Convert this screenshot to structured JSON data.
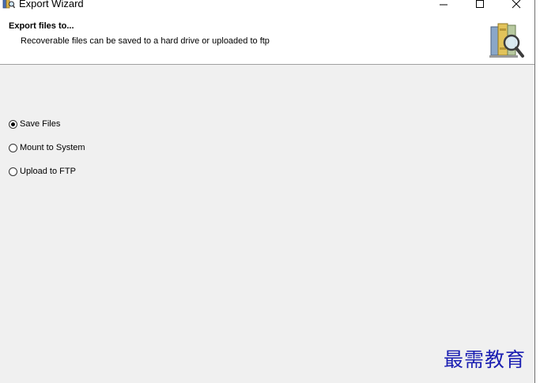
{
  "window": {
    "title": "Export Wizard",
    "controls": {
      "minimize_glyph": "—",
      "maximize_glyph": "☐",
      "close_glyph": "✕"
    }
  },
  "header": {
    "title": "Export files to...",
    "subtitle": "Recoverable files can be saved to a hard drive or uploaded to ftp",
    "icon": "books-magnifier-icon"
  },
  "options": [
    {
      "label": "Save Files",
      "selected": true
    },
    {
      "label": "Mount to System",
      "selected": false
    },
    {
      "label": "Upload to FTP",
      "selected": false
    }
  ],
  "watermark": "最需教育",
  "colors": {
    "window_bg": "#f0f0f0",
    "header_bg": "#ffffff",
    "watermark": "#1b1fb2"
  }
}
